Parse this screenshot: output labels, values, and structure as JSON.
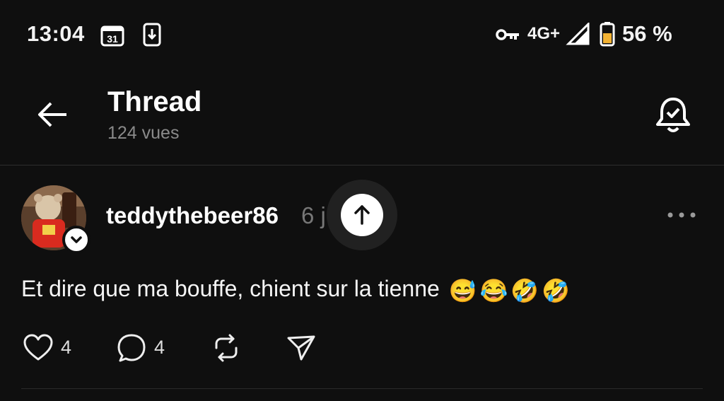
{
  "status_bar": {
    "time": "13:04",
    "calendar_day": "31",
    "network": "4G+",
    "battery": "56 %",
    "icons": [
      "calendar-icon",
      "download-icon",
      "vpn-key-icon",
      "signal-icon",
      "battery-icon"
    ]
  },
  "header": {
    "title": "Thread",
    "views": "124 vues",
    "icons": [
      "back-arrow-icon",
      "bell-check-icon"
    ]
  },
  "post": {
    "username": "teddythebeer86",
    "age": "6 j",
    "text": "Et dire que ma bouffe, chient sur la tienne",
    "emojis": [
      "😅",
      "😂",
      "🤣",
      "🤣"
    ],
    "likes": "4",
    "replies": "4",
    "icons": [
      "heart-icon",
      "reply-bubble-icon",
      "repost-icon",
      "send-icon",
      "more-icon",
      "chevron-down-icon",
      "arrow-up-icon"
    ]
  },
  "colors": {
    "background": "#0f0f0f",
    "text": "#f3f3f3",
    "muted": "#8a8a8a",
    "emoji_yellow": "#f7c325"
  }
}
